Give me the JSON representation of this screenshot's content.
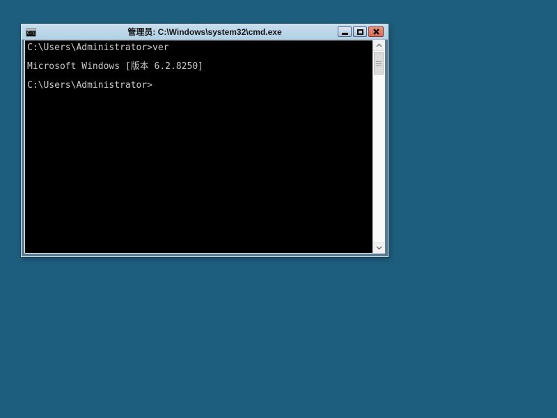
{
  "colors": {
    "desktop_background": "#1d5d7d",
    "titlebar_background": "#b8d5e8",
    "window_frame": "#58798f",
    "console_background": "#000000",
    "console_text": "#c9c9c9",
    "close_button": "#d96a57"
  },
  "window": {
    "title": "管理员: C:\\Windows\\system32\\cmd.exe",
    "controls": {
      "minimize": "minimize",
      "maximize": "maximize",
      "close": "close"
    },
    "app_icon": "cmd-prompt-icon"
  },
  "console": {
    "lines": [
      "C:\\Users\\Administrator>ver",
      "",
      "Microsoft Windows [版本 6.2.8250]",
      "",
      "C:\\Users\\Administrator>"
    ]
  },
  "scrollbar": {
    "up_icon": "chevron-up-icon",
    "down_icon": "chevron-down-icon"
  }
}
